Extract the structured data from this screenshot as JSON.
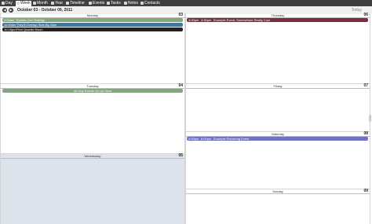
{
  "tabs": [
    {
      "label": "Day"
    },
    {
      "label": "Week"
    },
    {
      "label": "Month"
    },
    {
      "label": "Year"
    },
    {
      "label": "Timeline"
    },
    {
      "label": "Events"
    },
    {
      "label": "Tasks"
    },
    {
      "label": "Notes"
    },
    {
      "label": "Contacts"
    }
  ],
  "nav": {
    "prev": "◀",
    "next": "▶",
    "range": "October 03 - October 09, 2011",
    "today": "Today"
  },
  "days": {
    "monday": {
      "name": "Monday",
      "num": "03"
    },
    "tuesday": {
      "name": "Tuesday",
      "num": "04"
    },
    "wednesday": {
      "name": "Wednesday",
      "num": "05"
    },
    "thursday": {
      "name": "Thursday",
      "num": "06"
    },
    "friday": {
      "name": "Friday",
      "num": "07"
    },
    "saturday": {
      "name": "Saturday",
      "num": "08"
    },
    "sunday": {
      "name": "Sunday",
      "num": "09"
    }
  },
  "events": {
    "monday": [
      {
        "time": "2:00am",
        "title": "Events Can Overlap"
      },
      {
        "time": "11:00am",
        "title": "They'll Overlap Side-By-Side"
      },
      {
        "time": "10:15pm",
        "title": "First Quarter Moon"
      }
    ],
    "tuesday": [
      {
        "title": "All-Day Events Go Up Here"
      }
    ],
    "thursday": [
      {
        "time": "4:00pm - 4:30pm",
        "start": "4:00pm",
        "end": "4:30pm",
        "title": "Example Event, Somewhere Really Cool"
      }
    ],
    "saturday": [
      {
        "start": "4:00pm",
        "end": "6:00pm",
        "title": "Example Recurring Event"
      }
    ]
  },
  "colors": {
    "green": "#7fa97a",
    "blue": "#3b79a6",
    "black": "#222222",
    "maroon": "#7a2f3c",
    "purple": "#6f72c4",
    "wednesday_bg": "#dde3ec"
  }
}
